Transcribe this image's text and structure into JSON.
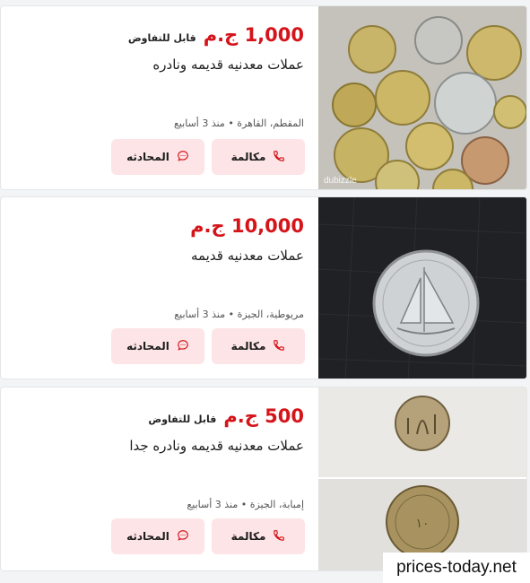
{
  "listings": [
    {
      "price": "1,000 ج.م",
      "negotiable": "قابل للتفاوض",
      "title": "عملات معدنيه قديمه ونادره",
      "meta": "المقطم، القاهرة • منذ 3 أسابيع",
      "call_label": "مكالمة",
      "chat_label": "المحادثه",
      "image_watermark": "dubizzle"
    },
    {
      "price": "10,000 ج.م",
      "negotiable": "",
      "title": "عملات معدنيه قديمه",
      "meta": "مريوطية، الجيزة • منذ 3 أسابيع",
      "call_label": "مكالمة",
      "chat_label": "المحادثه"
    },
    {
      "price": "500 ج.م",
      "negotiable": "قابل للتفاوض",
      "title": "عملات معدنيه قديمه ونادره جدا",
      "meta": "إمبابة، الجيزة • منذ 3 أسابيع",
      "call_label": "مكالمة",
      "chat_label": "المحادثه"
    }
  ],
  "watermark": "prices-today.net",
  "colors": {
    "price": "#d5141a",
    "button_bg": "#fde4e6",
    "accent": "#d5141a"
  },
  "icons": {
    "call": "phone-icon",
    "chat": "chat-bubble-icon"
  }
}
